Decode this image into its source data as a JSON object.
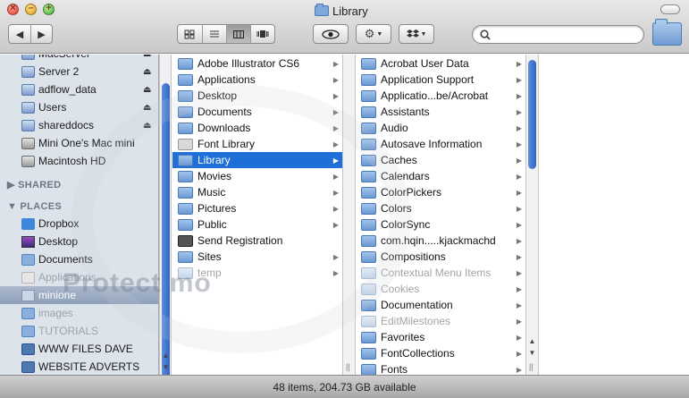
{
  "window": {
    "title": "Library"
  },
  "toolbar": {
    "back_glyph": "◀",
    "forward_glyph": "▶",
    "search_placeholder": "",
    "search_value": ""
  },
  "sidebar": {
    "devices": [
      {
        "label": "MacServer",
        "icon": "network-volume-icon",
        "eject": true
      },
      {
        "label": "Server 2",
        "icon": "network-volume-icon",
        "eject": true
      },
      {
        "label": "adflow_data",
        "icon": "network-volume-icon",
        "eject": true
      },
      {
        "label": "Users",
        "icon": "network-volume-icon",
        "eject": true
      },
      {
        "label": "shareddocs",
        "icon": "network-volume-icon",
        "eject": true
      },
      {
        "label": "Mini One's Mac mini",
        "icon": "computer-icon",
        "eject": false
      },
      {
        "label": "Macintosh HD",
        "icon": "hard-disk-icon",
        "eject": false
      }
    ],
    "shared_header": "SHARED",
    "places_header": "PLACES",
    "places": [
      {
        "label": "Dropbox",
        "icon": "dropbox-icon",
        "state": "normal"
      },
      {
        "label": "Desktop",
        "icon": "desktop-icon",
        "state": "normal"
      },
      {
        "label": "Documents",
        "icon": "folder-icon",
        "state": "normal"
      },
      {
        "label": "Applications",
        "icon": "applications-icon",
        "state": "dim"
      },
      {
        "label": "minione",
        "icon": "home-icon",
        "state": "selected"
      },
      {
        "label": "images",
        "icon": "folder-icon",
        "state": "dim"
      },
      {
        "label": "TUTORIALS",
        "icon": "folder-icon",
        "state": "dim"
      },
      {
        "label": "WWW FILES DAVE",
        "icon": "folder-icon",
        "state": "normal"
      },
      {
        "label": "WEBSITE ADVERTS",
        "icon": "folder-icon",
        "state": "normal"
      }
    ]
  },
  "column1": [
    {
      "label": "Adobe Illustrator CS6",
      "icon": "folder-icon",
      "has_children": true,
      "state": "normal"
    },
    {
      "label": "Applications",
      "icon": "applications-folder-icon",
      "has_children": true,
      "state": "normal"
    },
    {
      "label": "Desktop",
      "icon": "folder-icon",
      "has_children": true,
      "state": "normal"
    },
    {
      "label": "Documents",
      "icon": "folder-icon",
      "has_children": true,
      "state": "normal"
    },
    {
      "label": "Downloads",
      "icon": "downloads-folder-icon",
      "has_children": true,
      "state": "normal"
    },
    {
      "label": "Font Library",
      "icon": "font-file-icon",
      "has_children": true,
      "state": "normal"
    },
    {
      "label": "Library",
      "icon": "folder-icon",
      "has_children": true,
      "state": "selected"
    },
    {
      "label": "Movies",
      "icon": "movies-folder-icon",
      "has_children": true,
      "state": "normal"
    },
    {
      "label": "Music",
      "icon": "music-folder-icon",
      "has_children": true,
      "state": "normal"
    },
    {
      "label": "Pictures",
      "icon": "pictures-folder-icon",
      "has_children": true,
      "state": "normal"
    },
    {
      "label": "Public",
      "icon": "public-folder-icon",
      "has_children": true,
      "state": "normal"
    },
    {
      "label": "Send Registration",
      "icon": "registration-app-icon",
      "has_children": false,
      "state": "normal"
    },
    {
      "label": "Sites",
      "icon": "sites-folder-icon",
      "has_children": true,
      "state": "normal"
    },
    {
      "label": "temp",
      "icon": "folder-icon",
      "has_children": true,
      "state": "dim"
    }
  ],
  "column2": [
    {
      "label": "Acrobat User Data",
      "icon": "folder-icon",
      "has_children": true,
      "state": "normal"
    },
    {
      "label": "Application Support",
      "icon": "folder-icon",
      "has_children": true,
      "state": "normal"
    },
    {
      "label": "Applicatio...be/Acrobat",
      "icon": "folder-icon",
      "has_children": true,
      "state": "normal"
    },
    {
      "label": "Assistants",
      "icon": "folder-icon",
      "has_children": true,
      "state": "normal"
    },
    {
      "label": "Audio",
      "icon": "folder-icon",
      "has_children": true,
      "state": "normal"
    },
    {
      "label": "Autosave Information",
      "icon": "folder-icon",
      "has_children": true,
      "state": "normal"
    },
    {
      "label": "Caches",
      "icon": "folder-icon",
      "has_children": true,
      "state": "normal"
    },
    {
      "label": "Calendars",
      "icon": "folder-icon",
      "has_children": true,
      "state": "normal"
    },
    {
      "label": "ColorPickers",
      "icon": "folder-icon",
      "has_children": true,
      "state": "normal"
    },
    {
      "label": "Colors",
      "icon": "folder-icon",
      "has_children": true,
      "state": "normal"
    },
    {
      "label": "ColorSync",
      "icon": "folder-icon",
      "has_children": true,
      "state": "normal"
    },
    {
      "label": "com.hqin.....kjackmachd",
      "icon": "folder-icon",
      "has_children": true,
      "state": "normal"
    },
    {
      "label": "Compositions",
      "icon": "folder-icon",
      "has_children": true,
      "state": "normal"
    },
    {
      "label": "Contextual Menu Items",
      "icon": "folder-icon",
      "has_children": true,
      "state": "dim"
    },
    {
      "label": "Cookies",
      "icon": "folder-icon",
      "has_children": true,
      "state": "dim"
    },
    {
      "label": "Documentation",
      "icon": "folder-icon",
      "has_children": true,
      "state": "normal"
    },
    {
      "label": "EditMilestones",
      "icon": "folder-icon",
      "has_children": true,
      "state": "dim"
    },
    {
      "label": "Favorites",
      "icon": "folder-icon",
      "has_children": true,
      "state": "normal"
    },
    {
      "label": "FontCollections",
      "icon": "folder-icon",
      "has_children": true,
      "state": "normal"
    },
    {
      "label": "Fonts",
      "icon": "folder-icon",
      "has_children": true,
      "state": "normal"
    }
  ],
  "status": {
    "text": "48 items, 204.73 GB available"
  },
  "watermark": {
    "text": "Protect mo"
  },
  "colors": {
    "selection": "#1e6fd8",
    "sidebar_bg": "#dde3ea",
    "scroll_thumb": "#3a6fd0"
  }
}
